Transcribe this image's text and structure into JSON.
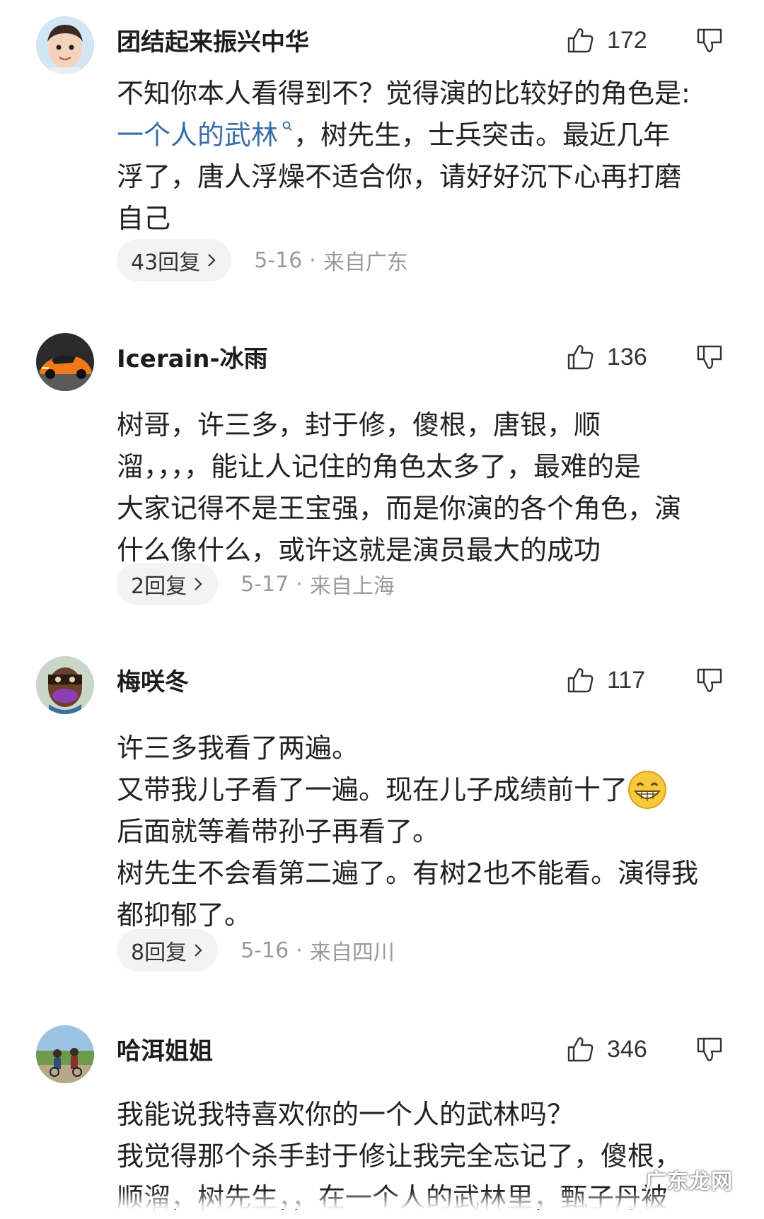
{
  "comments": [
    {
      "username": "团结起来振兴中华",
      "likes": "172",
      "lines": [
        [
          "不知你本人看得到不？觉得演的比较好的角色是:"
        ],
        [
          "一个人的武林",
          "，树先生，士兵突击。最近几年"
        ],
        [
          "浮了，唐人浮燥不适合你，请好好沉下心再打磨"
        ],
        [
          "自己"
        ]
      ],
      "replies": "43回复",
      "date": "5-16",
      "location": "来自广东",
      "avatar": "child-portrait"
    },
    {
      "username": "Icerain-冰雨",
      "likes": "136",
      "lines": [
        "树哥，许三多，封于修，傻根，唐银，顺",
        "溜，，，，能让人记住的角色太多了，最难的是",
        "大家记得不是王宝强，而是你演的各个角色，演",
        "什么像什么，或许这就是演员最大的成功"
      ],
      "replies": "2回复",
      "date": "5-17",
      "location": "来自上海",
      "avatar": "orange-sports-car"
    },
    {
      "username": "梅咲冬",
      "likes": "117",
      "lines": [
        "许三多我看了两遍。",
        "又带我儿子看了一遍。现在儿子成绩前十了",
        "后面就等着带孙子再看了。",
        "树先生不会看第二遍了。有树2也不能看。演得我",
        "都抑郁了。"
      ],
      "replies": "8回复",
      "date": "5-16",
      "location": "来自四川",
      "avatar": "masked-face-drawing",
      "emoji": "grinning-face-emoji"
    },
    {
      "username": "哈洱姐姐",
      "likes": "346",
      "lines": [
        "我能说我特喜欢你的一个人的武林吗？",
        "我觉得那个杀手封于修让我完全忘记了，傻根，",
        "顺溜，树先生，，在一个人的武林里，甄子丹被"
      ],
      "avatar": "outdoor-cyclists-photo"
    }
  ],
  "watermark": "广东龙网",
  "colors": {
    "text": "#222222",
    "link": "#3a6ea8",
    "meta": "#9a9a9a",
    "pill_bg": "#f3f3f3"
  },
  "icons": [
    "thumbs-up-icon",
    "thumbs-down-icon",
    "chevron-right-icon",
    "search-icon"
  ]
}
